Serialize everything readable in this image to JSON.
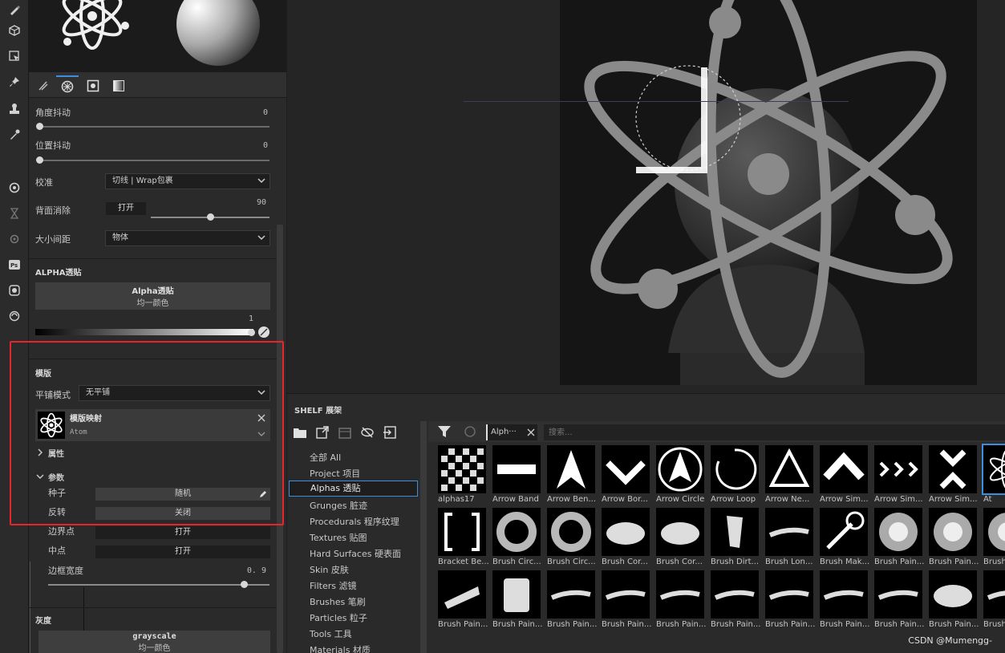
{
  "props": {
    "angle_jitter": {
      "label": "角度抖动",
      "value": "0"
    },
    "position_jitter": {
      "label": "位置抖动",
      "value": "0"
    },
    "alignment": {
      "label": "校准",
      "value": "切线 | Wrap包裹"
    },
    "backface_cull": {
      "label": "背面消除",
      "button": "打开",
      "value": "90"
    },
    "size_spacing": {
      "label": "大小间距",
      "value": "物体"
    },
    "alpha_section": {
      "title": "ALPHA透贴",
      "button_line1": "Alpha透贴",
      "button_line2": "均一颜色",
      "value": "1"
    },
    "stencil": {
      "title": "模版",
      "tile_mode_label": "平铺模式",
      "tile_mode_value": "无平铺",
      "map_title": "模版映射",
      "map_name": "Atom",
      "properties_label": "属性",
      "params_label": "参数",
      "seed_label": "种子",
      "seed_value": "随机",
      "invert_label": "反转",
      "invert_value": "关闭",
      "border_label": "边界点",
      "border_value": "打开",
      "center_label": "中点",
      "center_value": "打开",
      "border_width_label": "边框宽度",
      "border_width_value": "0. 9"
    },
    "gray_section": {
      "title": "灰度",
      "button_line1": "grayscale",
      "button_line2": "均一颜色"
    }
  },
  "shelf": {
    "title": "SHELF 展架",
    "categories": [
      {
        "label": "全部 All"
      },
      {
        "label": "Project 项目"
      },
      {
        "label": "Alphas 透贴"
      },
      {
        "label": "Grunges 脏迹"
      },
      {
        "label": "Procedurals 程序纹理"
      },
      {
        "label": "Textures 贴图"
      },
      {
        "label": "Hard Surfaces 硬表面"
      },
      {
        "label": "Skin 皮肤"
      },
      {
        "label": "Filters 滤镜"
      },
      {
        "label": "Brushes 笔刷"
      },
      {
        "label": "Particles 粒子"
      },
      {
        "label": "Tools 工具"
      },
      {
        "label": "Materials 材质"
      }
    ],
    "active_category": "Alphas 透贴",
    "tag_chip": "Alph···",
    "search_placeholder": "搜索...",
    "row1": [
      "alphas17",
      "Arrow Band",
      "Arrow Ben...",
      "Arrow Bor...",
      "Arrow Circle",
      "Arrow Loop",
      "Arrow Ne...",
      "Arrow Sim...",
      "Arrow Sim...",
      "Arrow Sim...",
      "At"
    ],
    "row2": [
      "Bracket Be...",
      "Brush Circ...",
      "Brush Circ...",
      "Brush Cor...",
      "Brush Cor...",
      "Brush Dirt...",
      "Brush Lon...",
      "Brush Mak...",
      "Brush Pain...",
      "Brush Pain...",
      "Brush"
    ],
    "row3": [
      "Brush Pain...",
      "Brush Pain...",
      "Brush Pain...",
      "Brush Pain...",
      "Brush Pain...",
      "Brush Pain...",
      "Brush Pain...",
      "Brush Pain...",
      "Brush Pain...",
      "Brush Pain...",
      "Brush"
    ]
  },
  "watermark": "CSDN @Mumengg-"
}
